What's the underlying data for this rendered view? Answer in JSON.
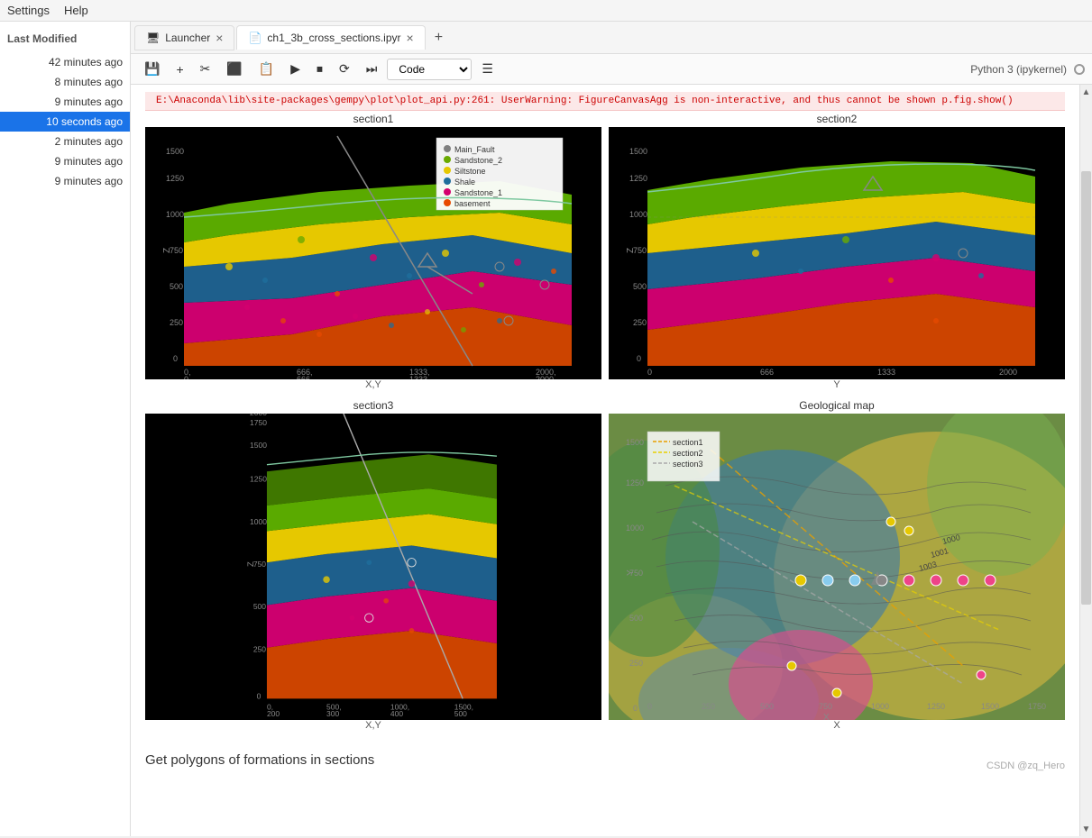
{
  "menubar": {
    "items": [
      "Settings",
      "Help"
    ]
  },
  "tabs": [
    {
      "label": "Launcher",
      "icon": "🖥",
      "active": false,
      "closable": true
    },
    {
      "label": "ch1_3b_cross_sections.ipyr",
      "icon": "📄",
      "active": true,
      "closable": true
    }
  ],
  "toolbar": {
    "buttons": [
      "💾",
      "+",
      "✂",
      "⬛",
      "▶",
      "⏹",
      "⟳",
      "⏭"
    ],
    "cell_type": "Code",
    "kernel": "Python 3 (ipykernel)"
  },
  "warning": "E:\\Anaconda\\lib\\site-packages\\gempy\\plot\\plot_api.py:261: UserWarning: FigureCanvasAgg is non-interactive, and thus cannot be shown\n  p.fig.show()",
  "sidebar": {
    "header": "Last Modified",
    "items": [
      {
        "label": "42 minutes ago",
        "active": false
      },
      {
        "label": "8 minutes ago",
        "active": false
      },
      {
        "label": "9 minutes ago",
        "active": false
      },
      {
        "label": "10 seconds ago",
        "active": true
      },
      {
        "label": "2 minutes ago",
        "active": false
      },
      {
        "label": "9 minutes ago",
        "active": false
      },
      {
        "label": "9 minutes ago",
        "active": false
      }
    ]
  },
  "plots": {
    "section1": {
      "title": "section1",
      "xlabel": "X,Y"
    },
    "section2": {
      "title": "section2",
      "xlabel": "Y"
    },
    "section3": {
      "title": "section3",
      "xlabel": "X,Y"
    },
    "geological": {
      "title": "Geological map",
      "xlabel": "X"
    }
  },
  "legend": {
    "items": [
      {
        "label": "Main_Fault",
        "color": "#808080"
      },
      {
        "label": "Sandstone_2",
        "color": "#6aaa00"
      },
      {
        "label": "Siltstone",
        "color": "#e6c800"
      },
      {
        "label": "Shale",
        "color": "#1e6e9c"
      },
      {
        "label": "Sandstone_1",
        "color": "#d4006e"
      },
      {
        "label": "basement",
        "color": "#e84a00"
      }
    ]
  },
  "bottom_text": "Get polygons of formations in sections",
  "attribution": "CSDN @zq_Hero"
}
